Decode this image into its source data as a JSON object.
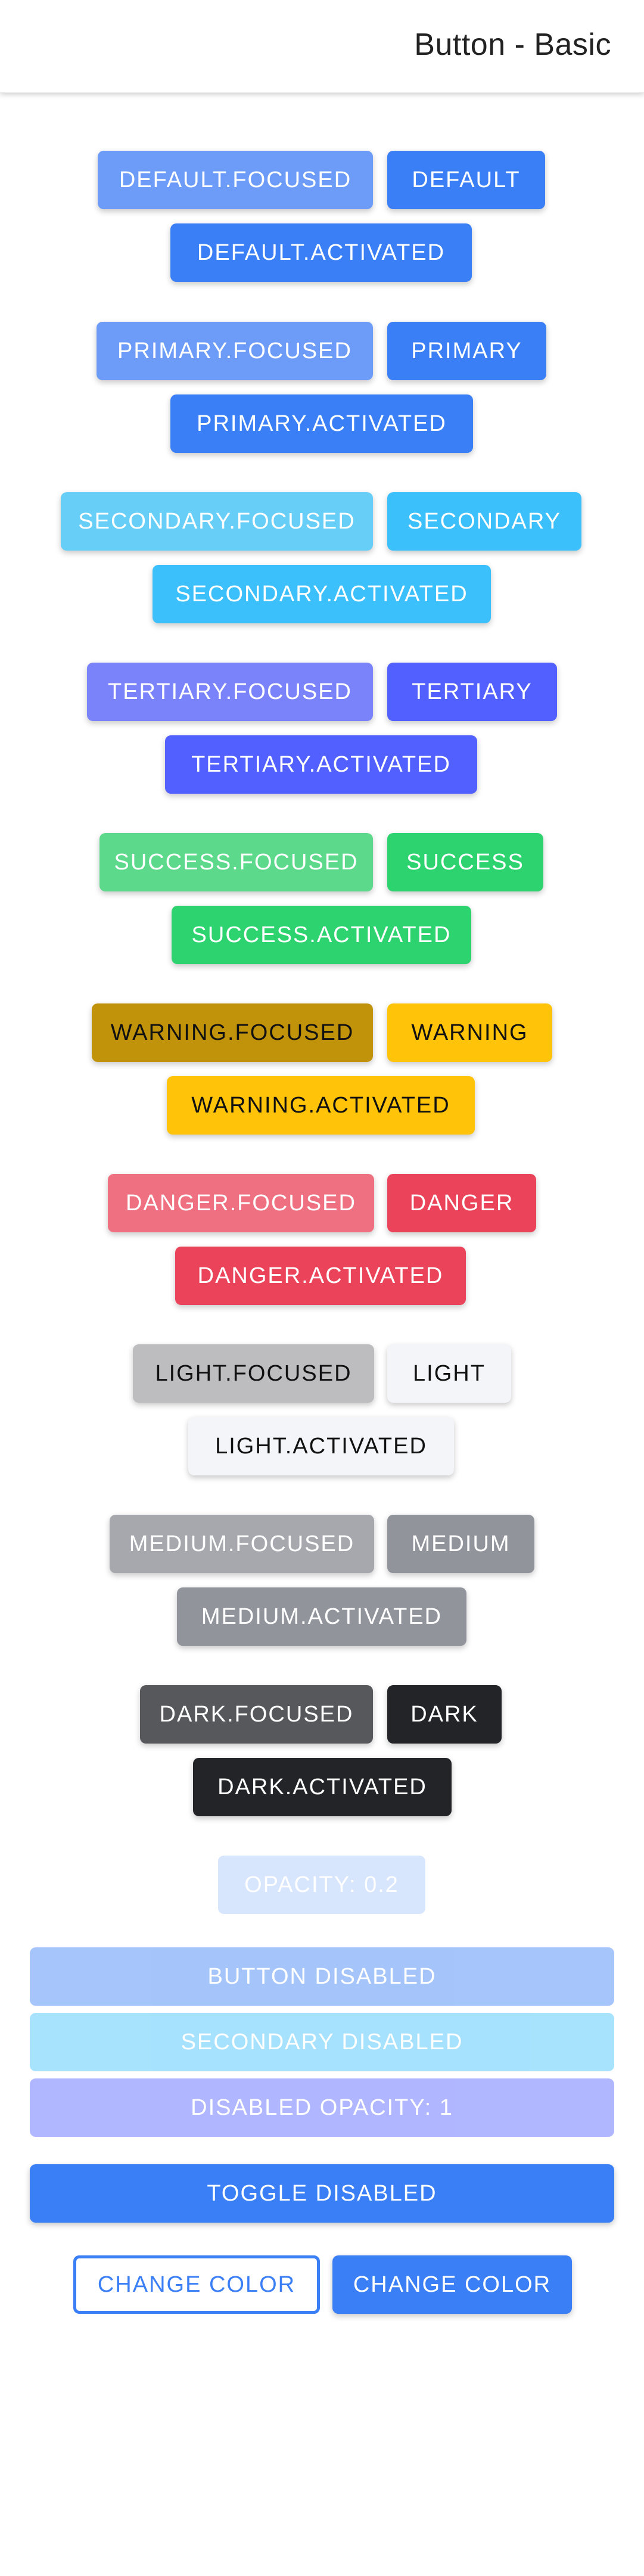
{
  "header": {
    "title": "Button - Basic"
  },
  "groups": [
    {
      "focused": "DEFAULT.FOCUSED",
      "normal": "DEFAULT",
      "activated": "DEFAULT.ACTIVATED",
      "color": "#3a7ff6"
    },
    {
      "focused": "PRIMARY.FOCUSED",
      "normal": "PRIMARY",
      "activated": "PRIMARY.ACTIVATED",
      "color": "#3a7ff6"
    },
    {
      "focused": "SECONDARY.FOCUSED",
      "normal": "SECONDARY",
      "activated": "SECONDARY.ACTIVATED",
      "color": "#3cc0fb"
    },
    {
      "focused": "TERTIARY.FOCUSED",
      "normal": "TERTIARY",
      "activated": "TERTIARY.ACTIVATED",
      "color": "#5260ff"
    },
    {
      "focused": "SUCCESS.FOCUSED",
      "normal": "SUCCESS",
      "activated": "SUCCESS.ACTIVATED",
      "color": "#2dd36f"
    },
    {
      "focused": "WARNING.FOCUSED",
      "normal": "WARNING",
      "activated": "WARNING.ACTIVATED",
      "color": "#ffc409"
    },
    {
      "focused": "DANGER.FOCUSED",
      "normal": "DANGER",
      "activated": "DANGER.ACTIVATED",
      "color": "#eb445a"
    },
    {
      "focused": "LIGHT.FOCUSED",
      "normal": "LIGHT",
      "activated": "LIGHT.ACTIVATED",
      "color": "#f4f5f8"
    },
    {
      "focused": "MEDIUM.FOCUSED",
      "normal": "MEDIUM",
      "activated": "MEDIUM.ACTIVATED",
      "color": "#92949c"
    },
    {
      "focused": "DARK.FOCUSED",
      "normal": "DARK",
      "activated": "DARK.ACTIVATED",
      "color": "#222428"
    }
  ],
  "opacity_button": "OPACITY: 0.2",
  "button_disabled": "BUTTON DISABLED",
  "secondary_disabled": "SECONDARY DISABLED",
  "disabled_opacity": "DISABLED OPACITY: 1",
  "toggle_disabled": "TOGGLE DISABLED",
  "change_color_outline": "CHANGE COLOR",
  "change_color_solid": "CHANGE COLOR"
}
